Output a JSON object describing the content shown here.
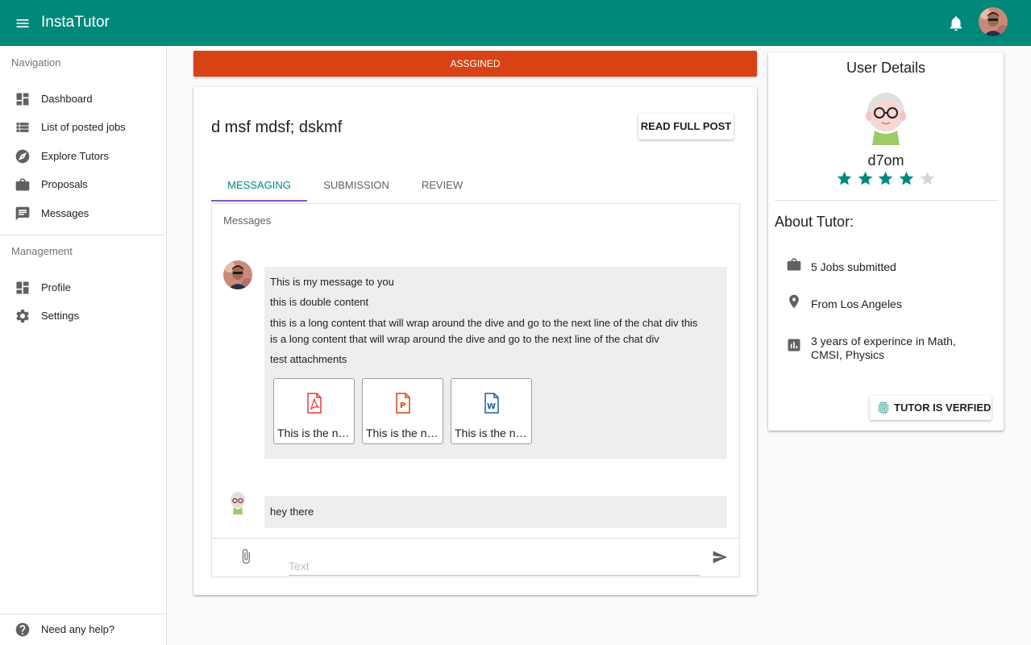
{
  "app": {
    "title": "InstaTutor"
  },
  "sidebar": {
    "nav_header": "Navigation",
    "nav_items": [
      {
        "label": "Dashboard",
        "icon": "dashboard-icon"
      },
      {
        "label": "List of posted jobs",
        "icon": "list-icon"
      },
      {
        "label": "Explore Tutors",
        "icon": "compass-icon"
      },
      {
        "label": "Proposals",
        "icon": "briefcase-icon"
      },
      {
        "label": "Messages",
        "icon": "chat-icon"
      }
    ],
    "mgmt_header": "Management",
    "mgmt_items": [
      {
        "label": "Profile",
        "icon": "dashboard-icon"
      },
      {
        "label": "Settings",
        "icon": "gear-icon"
      }
    ],
    "help": "Need any help?"
  },
  "status": {
    "label": "ASSGINED",
    "color": "#d84315"
  },
  "post": {
    "title": "d msf mdsf; dskmf",
    "read_button": "READ FULL POST"
  },
  "tabs": [
    {
      "label": "MESSAGING",
      "active": true
    },
    {
      "label": "SUBMISSION",
      "active": false
    },
    {
      "label": "REVIEW",
      "active": false
    }
  ],
  "messages": {
    "header": "Messages",
    "items": [
      {
        "lines": [
          "This is my message to you",
          "this is double content",
          "this is a long content that will wrap around the dive and go to the next line of the chat div this",
          "is a long content that will wrap around the dive and go to the next line of the chat div",
          "test attachments"
        ],
        "attachments": [
          {
            "name": "This is the name of the file",
            "icon": "pdf-icon",
            "color": "#e53935"
          },
          {
            "name": "This is the name of the file",
            "icon": "powerpoint-icon",
            "color": "#d84315"
          },
          {
            "name": "This is the name of the file",
            "icon": "word-icon",
            "color": "#1e5aa8"
          }
        ]
      },
      {
        "lines": [
          "hey there"
        ]
      }
    ],
    "input_placeholder": "Text"
  },
  "user_details": {
    "title": "User Details",
    "name": "d7om",
    "rating": 4,
    "rating_max": 5,
    "about_header": "About Tutor:",
    "details": [
      {
        "text": "5 Jobs submitted",
        "icon": "briefcase-icon"
      },
      {
        "text": "From Los Angeles",
        "icon": "location-pin-icon"
      },
      {
        "text": "3 years of experince in Math, CMSI, Physics",
        "icon": "chart-icon"
      }
    ],
    "verified_button": "TUTOR IS VERFIED"
  },
  "colors": {
    "primary": "#00897b",
    "tab_indicator": "#7e57c2"
  }
}
